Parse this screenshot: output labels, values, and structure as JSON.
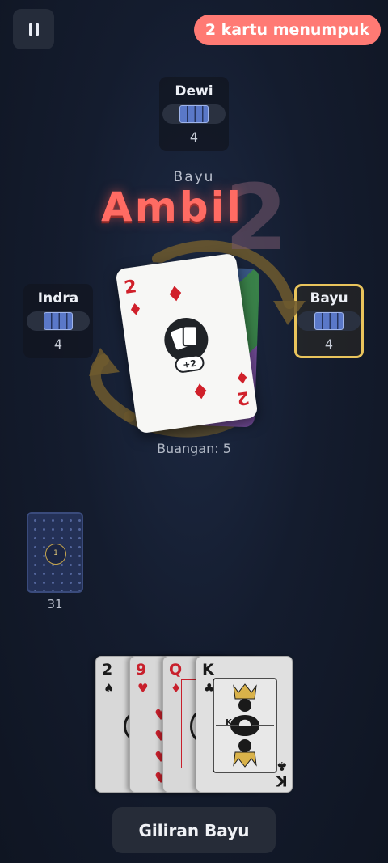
{
  "header": {
    "pause_icon": "pause-icon",
    "stack_badge": "2 kartu menumpuk",
    "stack_badge_color": "#ff7a74"
  },
  "players": {
    "top": {
      "name": "Dewi",
      "count": "4"
    },
    "left": {
      "name": "Indra",
      "count": "4"
    },
    "right": {
      "name": "Bayu",
      "count": "4",
      "active": true,
      "highlight_color": "#e9c45c"
    }
  },
  "center": {
    "turn_name": "Bayu",
    "action_text": "Ambil",
    "action_amount": "2",
    "top_card": {
      "rank": "2",
      "suit": "♦",
      "badge": "+2",
      "color": "#d0202a"
    },
    "discard_label": "Buangan: 5"
  },
  "draw_pile": {
    "coin": "1",
    "count": "31"
  },
  "hand": [
    {
      "rank": "2",
      "suit": "♠",
      "color": "black"
    },
    {
      "rank": "9",
      "suit": "♥",
      "color": "red"
    },
    {
      "rank": "Q",
      "suit": "♦",
      "color": "red"
    },
    {
      "rank": "K",
      "suit": "♣",
      "color": "black",
      "corner": "K"
    }
  ],
  "footer": {
    "turn_button": "Giliran Bayu"
  }
}
